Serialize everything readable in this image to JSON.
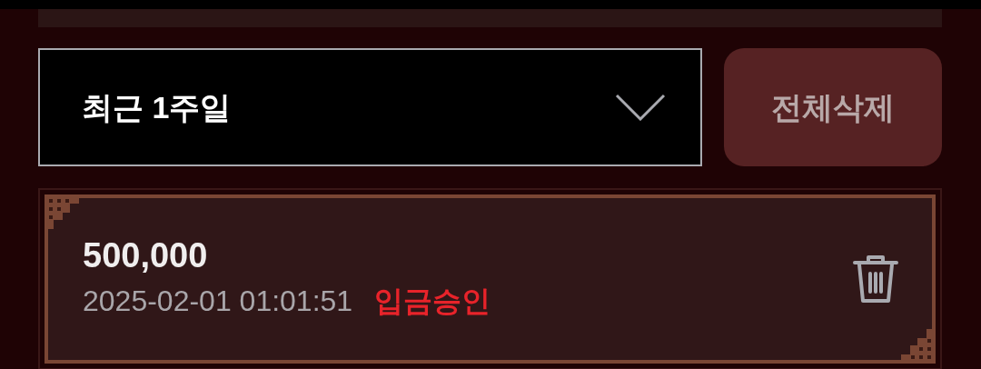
{
  "filter": {
    "value": "최근 1주일"
  },
  "delete_all_button": "전체삭제",
  "records": [
    {
      "amount": "500,000",
      "datetime": "2025-02-01 01:01:51",
      "status": "입금승인"
    }
  ]
}
